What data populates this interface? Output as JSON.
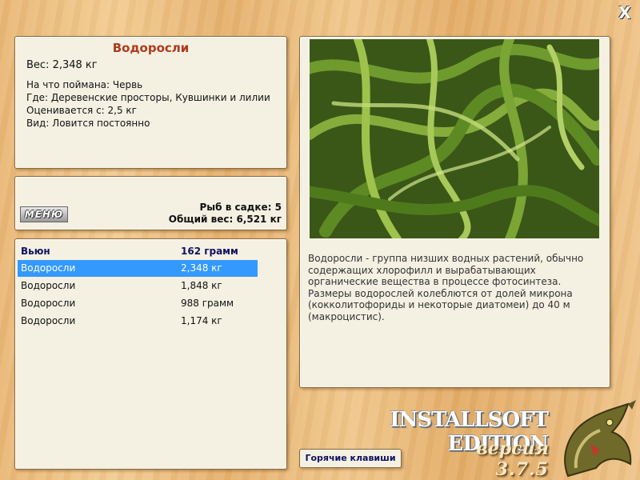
{
  "close_label": "X",
  "info": {
    "title": "Водоросли",
    "weight": "Вес: 2,348 кг",
    "caught_on": "На что поймана: Червь",
    "where": "Где: Деревенские просторы, Кувшинки и лилии",
    "valued_from": "Оценивается с: 2,5 кг",
    "kind": "Вид: Ловится постоянно"
  },
  "menu": {
    "button_label": "МЕНЮ",
    "fish_in_cage": "Рыб в садке: 5",
    "total_weight": "Общий вес: 6,521 кг"
  },
  "catch_list": {
    "header": {
      "name": "Вьюн",
      "weight": "162 грамм"
    },
    "rows": [
      {
        "name": "Водоросли",
        "weight": "2,348 кг",
        "selected": true
      },
      {
        "name": "Водоросли",
        "weight": "1,848 кг",
        "selected": false
      },
      {
        "name": "Водоросли",
        "weight": "988 грамм",
        "selected": false
      },
      {
        "name": "Водоросли",
        "weight": "1,174 кг",
        "selected": false
      }
    ]
  },
  "description": "Водоросли - группа низших водных растений, обычно содержащих хлорофилл и вырабатывающих органические вещества в процессе фотосинтеза. Размеры водорослей колеблются от долей микрона (кокколитофориды и некоторые диатомеи) до 40 м (макроцистис).",
  "hotkeys_label": "Горячие клавиши",
  "brand": "INSTALLSOFT EDITION",
  "version_word": "версия",
  "version_number": "3.7.5",
  "colors": {
    "title_red": "#b03a1a",
    "selection_blue": "#3399ff",
    "header_navy": "#101060"
  }
}
